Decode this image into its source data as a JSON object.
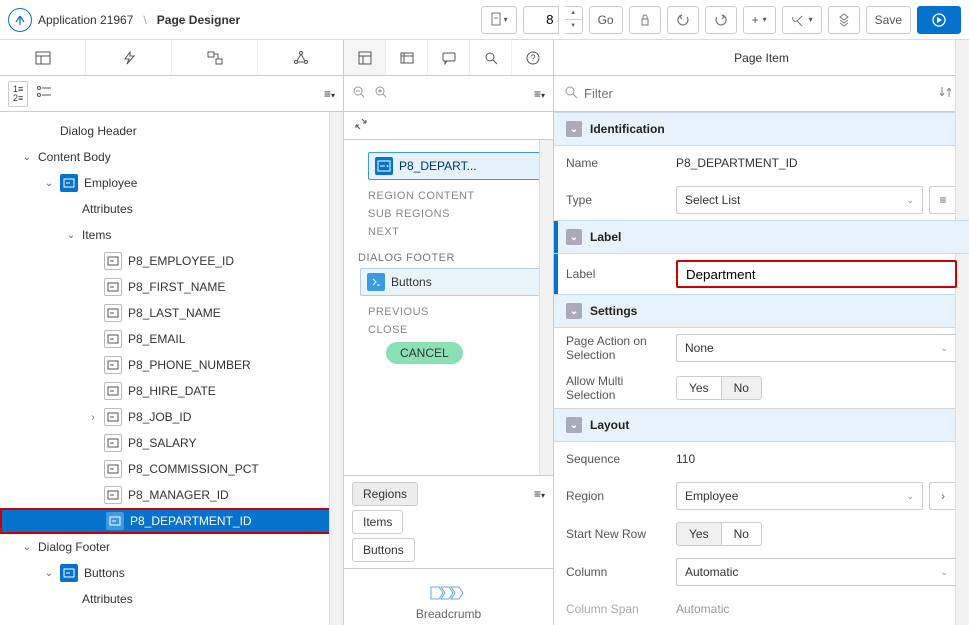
{
  "breadcrumb": {
    "app": "Application 21967",
    "page": "Page Designer"
  },
  "toolbar": {
    "page_num": "8",
    "go": "Go",
    "save": "Save"
  },
  "left_tree": {
    "nodes": [
      {
        "depth": 1,
        "chev": "",
        "icon": "",
        "label": "Dialog Header"
      },
      {
        "depth": 0,
        "chev": "down",
        "icon": "",
        "label": "Content Body"
      },
      {
        "depth": 1,
        "chev": "down",
        "icon": "blue",
        "label": "Employee"
      },
      {
        "depth": 2,
        "chev": "",
        "icon": "",
        "label": "Attributes"
      },
      {
        "depth": 2,
        "chev": "down",
        "icon": "",
        "label": "Items"
      },
      {
        "depth": 3,
        "chev": "",
        "icon": "grey",
        "label": "P8_EMPLOYEE_ID"
      },
      {
        "depth": 3,
        "chev": "",
        "icon": "grey",
        "label": "P8_FIRST_NAME"
      },
      {
        "depth": 3,
        "chev": "",
        "icon": "grey",
        "label": "P8_LAST_NAME"
      },
      {
        "depth": 3,
        "chev": "",
        "icon": "grey",
        "label": "P8_EMAIL"
      },
      {
        "depth": 3,
        "chev": "",
        "icon": "grey",
        "label": "P8_PHONE_NUMBER"
      },
      {
        "depth": 3,
        "chev": "",
        "icon": "grey",
        "label": "P8_HIRE_DATE"
      },
      {
        "depth": 3,
        "chev": "right",
        "icon": "grey",
        "label": "P8_JOB_ID"
      },
      {
        "depth": 3,
        "chev": "",
        "icon": "grey",
        "label": "P8_SALARY"
      },
      {
        "depth": 3,
        "chev": "",
        "icon": "grey",
        "label": "P8_COMMISSION_PCT"
      },
      {
        "depth": 3,
        "chev": "",
        "icon": "grey",
        "label": "P8_MANAGER_ID"
      },
      {
        "depth": 3,
        "chev": "",
        "icon": "bluebox",
        "label": "P8_DEPARTMENT_ID",
        "selected": true
      },
      {
        "depth": 0,
        "chev": "down",
        "icon": "",
        "label": "Dialog Footer"
      },
      {
        "depth": 1,
        "chev": "down",
        "icon": "blue",
        "label": "Buttons"
      },
      {
        "depth": 2,
        "chev": "",
        "icon": "",
        "label": "Attributes"
      }
    ]
  },
  "mid": {
    "region_label": "P8_DEPART...",
    "section_labels": {
      "region_content": "REGION CONTENT",
      "sub_regions": "SUB REGIONS",
      "next": "NEXT",
      "dialog_footer": "DIALOG FOOTER",
      "previous": "PREVIOUS",
      "close": "CLOSE"
    },
    "buttons_region": "Buttons",
    "cancel": "CANCEL",
    "gallery_tabs": {
      "regions": "Regions",
      "items": "Items",
      "buttons": "Buttons"
    },
    "gallery_item": "Breadcrumb"
  },
  "right": {
    "tab": "Page Item",
    "filter_placeholder": "Filter",
    "sections": {
      "identification": {
        "title": "Identification",
        "name": {
          "label": "Name",
          "value": "P8_DEPARTMENT_ID"
        },
        "type": {
          "label": "Type",
          "value": "Select List"
        }
      },
      "label": {
        "title": "Label",
        "label": {
          "label": "Label",
          "value": "Department"
        }
      },
      "settings": {
        "title": "Settings",
        "page_action": {
          "label": "Page Action on Selection",
          "value": "None"
        },
        "multi": {
          "label": "Allow Multi Selection",
          "yes": "Yes",
          "no": "No"
        }
      },
      "layout": {
        "title": "Layout",
        "sequence": {
          "label": "Sequence",
          "value": "110"
        },
        "region": {
          "label": "Region",
          "value": "Employee"
        },
        "start_row": {
          "label": "Start New Row",
          "yes": "Yes",
          "no": "No"
        },
        "column": {
          "label": "Column",
          "value": "Automatic"
        },
        "column_span": {
          "label": "Column Span",
          "value": "Automatic"
        }
      }
    }
  }
}
